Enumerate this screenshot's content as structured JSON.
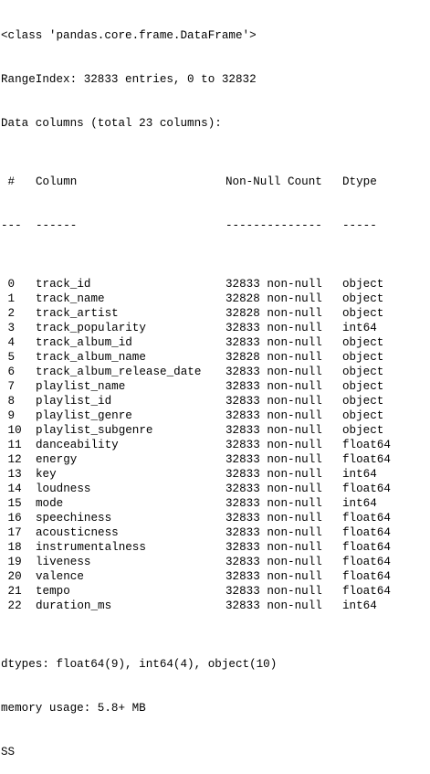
{
  "header": {
    "class_line": "<class 'pandas.core.frame.DataFrame'>",
    "range_index": "RangeIndex: 32833 entries, 0 to 32832",
    "data_columns": "Data columns (total 23 columns):"
  },
  "table": {
    "head": {
      "num": " #",
      "column": "Column",
      "count": "Non-Null Count",
      "dtype": "Dtype"
    },
    "rule": {
      "num": "---",
      "column": "------",
      "count": "--------------",
      "dtype": "-----"
    },
    "rows": [
      {
        "num": " 0",
        "column": "track_id",
        "count": "32833 non-null",
        "dtype": "object"
      },
      {
        "num": " 1",
        "column": "track_name",
        "count": "32828 non-null",
        "dtype": "object"
      },
      {
        "num": " 2",
        "column": "track_artist",
        "count": "32828 non-null",
        "dtype": "object"
      },
      {
        "num": " 3",
        "column": "track_popularity",
        "count": "32833 non-null",
        "dtype": "int64"
      },
      {
        "num": " 4",
        "column": "track_album_id",
        "count": "32833 non-null",
        "dtype": "object"
      },
      {
        "num": " 5",
        "column": "track_album_name",
        "count": "32828 non-null",
        "dtype": "object"
      },
      {
        "num": " 6",
        "column": "track_album_release_date",
        "count": "32833 non-null",
        "dtype": "object"
      },
      {
        "num": " 7",
        "column": "playlist_name",
        "count": "32833 non-null",
        "dtype": "object"
      },
      {
        "num": " 8",
        "column": "playlist_id",
        "count": "32833 non-null",
        "dtype": "object"
      },
      {
        "num": " 9",
        "column": "playlist_genre",
        "count": "32833 non-null",
        "dtype": "object"
      },
      {
        "num": " 10",
        "column": "playlist_subgenre",
        "count": "32833 non-null",
        "dtype": "object"
      },
      {
        "num": " 11",
        "column": "danceability",
        "count": "32833 non-null",
        "dtype": "float64"
      },
      {
        "num": " 12",
        "column": "energy",
        "count": "32833 non-null",
        "dtype": "float64"
      },
      {
        "num": " 13",
        "column": "key",
        "count": "32833 non-null",
        "dtype": "int64"
      },
      {
        "num": " 14",
        "column": "loudness",
        "count": "32833 non-null",
        "dtype": "float64"
      },
      {
        "num": " 15",
        "column": "mode",
        "count": "32833 non-null",
        "dtype": "int64"
      },
      {
        "num": " 16",
        "column": "speechiness",
        "count": "32833 non-null",
        "dtype": "float64"
      },
      {
        "num": " 17",
        "column": "acousticness",
        "count": "32833 non-null",
        "dtype": "float64"
      },
      {
        "num": " 18",
        "column": "instrumentalness",
        "count": "32833 non-null",
        "dtype": "float64"
      },
      {
        "num": " 19",
        "column": "liveness",
        "count": "32833 non-null",
        "dtype": "float64"
      },
      {
        "num": " 20",
        "column": "valence",
        "count": "32833 non-null",
        "dtype": "float64"
      },
      {
        "num": " 21",
        "column": "tempo",
        "count": "32833 non-null",
        "dtype": "float64"
      },
      {
        "num": " 22",
        "column": "duration_ms",
        "count": "32833 non-null",
        "dtype": "int64"
      }
    ]
  },
  "footer": {
    "dtypes": "dtypes: float64(9), int64(4), object(10)",
    "memory": "memory usage: 5.8+ MB",
    "prompt": "SS"
  }
}
